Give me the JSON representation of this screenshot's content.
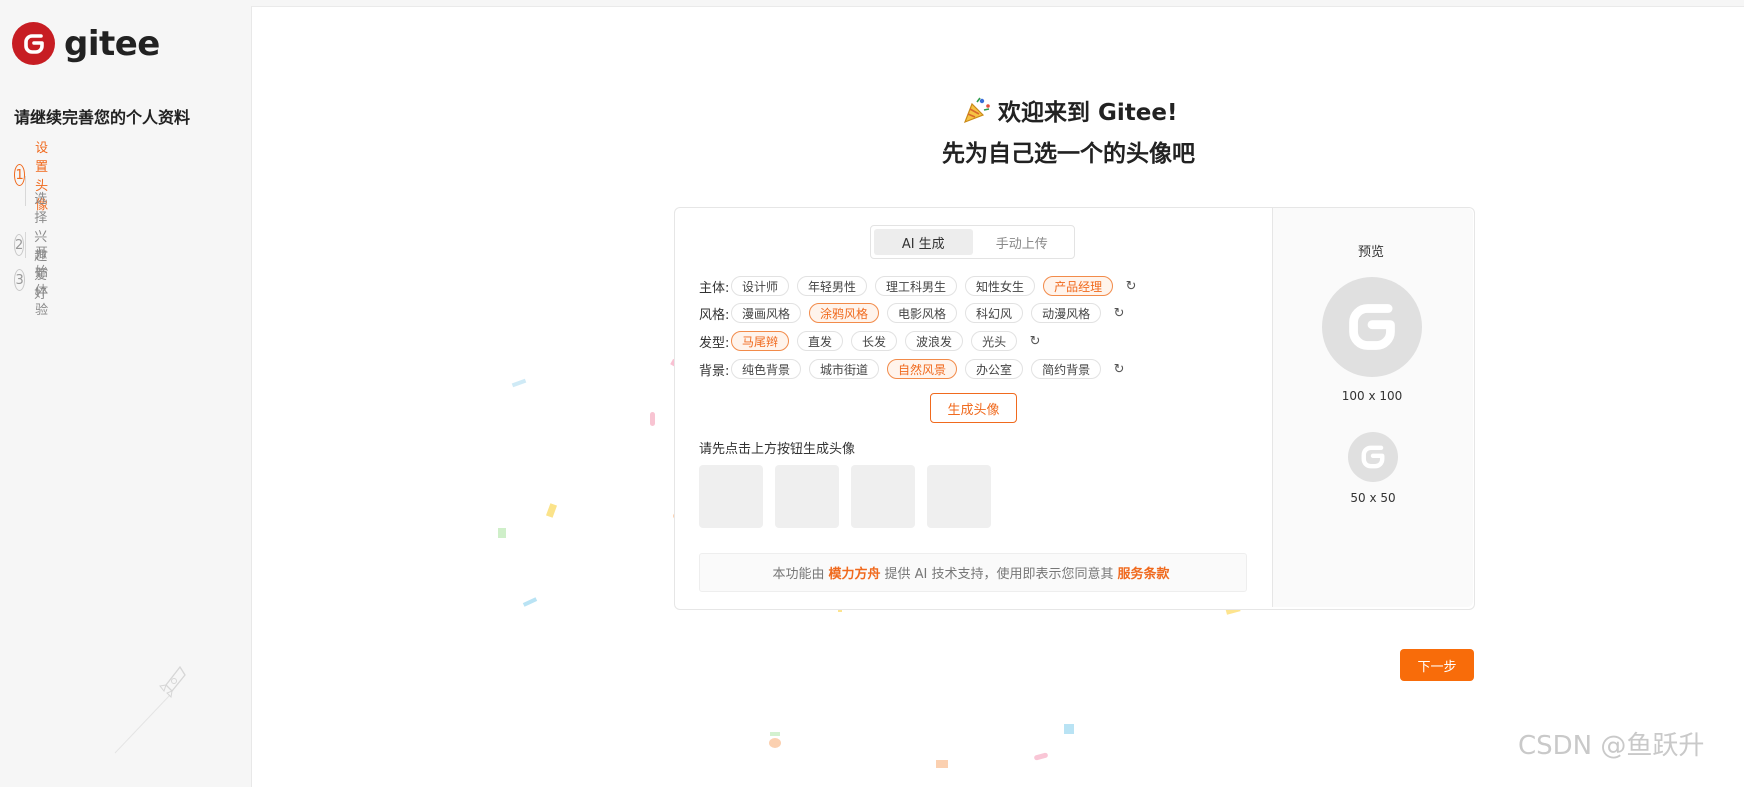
{
  "brand": {
    "name": "gitee",
    "color": "#c71d23"
  },
  "accent": "#f06a1e",
  "sidebar": {
    "title": "请继续完善您的个人资料",
    "steps": [
      {
        "num": "1",
        "label": "设置头像",
        "active": true
      },
      {
        "num": "2",
        "label": "选择兴趣爱好",
        "active": false
      },
      {
        "num": "3",
        "label": "开始体验",
        "active": false
      }
    ]
  },
  "header": {
    "welcome": "欢迎来到 Gitee!",
    "subtitle": "先为自己选一个的头像吧"
  },
  "tabs": [
    {
      "label": "AI 生成",
      "active": true
    },
    {
      "label": "手动上传",
      "active": false
    }
  ],
  "options": [
    {
      "label": "主体:",
      "chips": [
        "设计师",
        "年轻男性",
        "理工科男生",
        "知性女生",
        "产品经理"
      ],
      "selected": 4
    },
    {
      "label": "风格:",
      "chips": [
        "漫画风格",
        "涂鸦风格",
        "电影风格",
        "科幻风",
        "动漫风格"
      ],
      "selected": 1
    },
    {
      "label": "发型:",
      "chips": [
        "马尾辫",
        "直发",
        "长发",
        "波浪发",
        "光头"
      ],
      "selected": 0
    },
    {
      "label": "背景:",
      "chips": [
        "纯色背景",
        "城市街道",
        "自然风景",
        "办公室",
        "简约背景"
      ],
      "selected": 2
    }
  ],
  "generate_button": "生成头像",
  "hint": "请先点击上方按钮生成头像",
  "notice": {
    "prefix": "本功能由",
    "provider": "模力方舟",
    "middle": "提供 AI 技术支持，使用即表示您同意其",
    "terms": "服务条款"
  },
  "preview": {
    "title": "预览",
    "large_size": "100 x 100",
    "small_size": "50 x 50"
  },
  "next_button": "下一步",
  "watermark": "CSDN @鱼跃升",
  "icons": {
    "logo": "gitee-logo-icon",
    "party": "party-popper-icon",
    "refresh": "refresh-icon",
    "rocket": "rocket-icon",
    "avatar": "gitee-avatar-icon"
  }
}
